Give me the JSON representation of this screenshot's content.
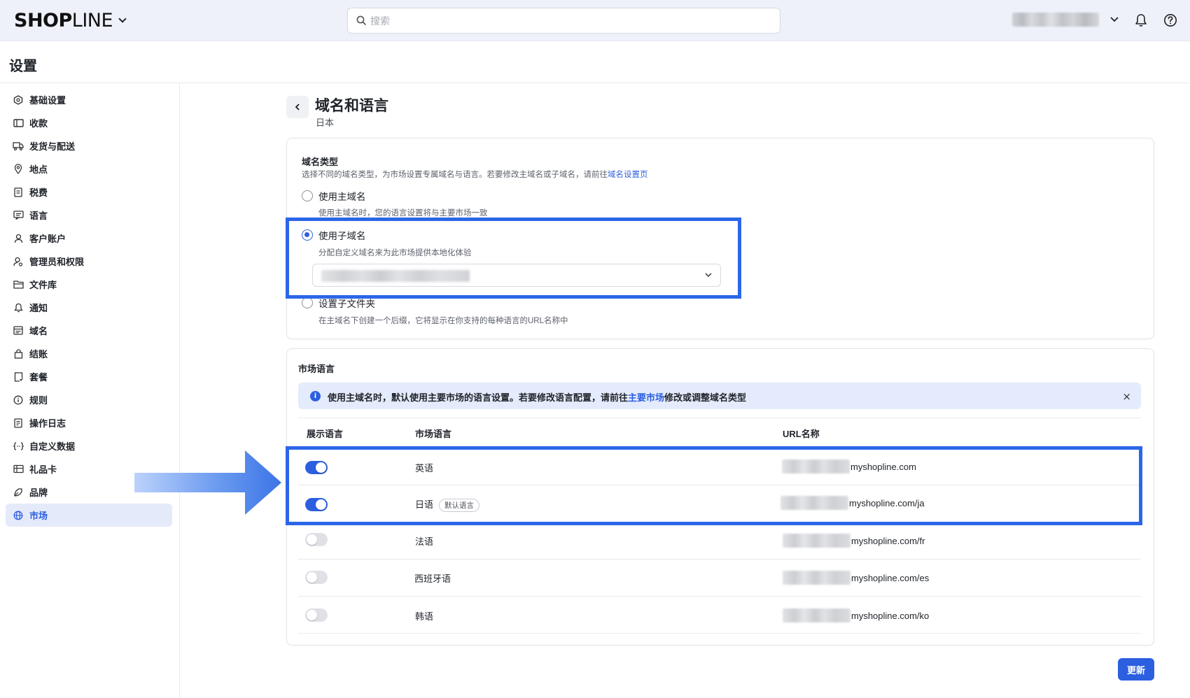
{
  "header": {
    "logo_bold": "SHOP",
    "logo_light": "LINE",
    "search_placeholder": "搜索"
  },
  "page": {
    "title": "设置"
  },
  "sidebar": {
    "items": [
      {
        "label": "基础设置",
        "icon": "hexagon-icon"
      },
      {
        "label": "收款",
        "icon": "wallet-icon"
      },
      {
        "label": "发货与配送",
        "icon": "truck-icon"
      },
      {
        "label": "地点",
        "icon": "location-pin-icon"
      },
      {
        "label": "税费",
        "icon": "receipt-icon"
      },
      {
        "label": "语言",
        "icon": "translate-icon"
      },
      {
        "label": "客户账户",
        "icon": "user-icon"
      },
      {
        "label": "管理员和权限",
        "icon": "admin-user-icon"
      },
      {
        "label": "文件库",
        "icon": "folder-icon"
      },
      {
        "label": "通知",
        "icon": "bell-icon"
      },
      {
        "label": "域名",
        "icon": "domain-icon"
      },
      {
        "label": "结账",
        "icon": "shopping-bag-icon"
      },
      {
        "label": "套餐",
        "icon": "plan-icon"
      },
      {
        "label": "规则",
        "icon": "info-circle-icon"
      },
      {
        "label": "操作日志",
        "icon": "log-icon"
      },
      {
        "label": "自定义数据",
        "icon": "code-braces-icon"
      },
      {
        "label": "礼品卡",
        "icon": "gift-card-icon"
      },
      {
        "label": "品牌",
        "icon": "brand-icon"
      },
      {
        "label": "市场",
        "icon": "globe-icon",
        "active": true
      }
    ]
  },
  "content": {
    "title": "域名和语言",
    "subtitle": "日本",
    "domain_type": {
      "title": "域名类型",
      "desc": "选择不同的域名类型，为市场设置专属域名与语言。若要修改主域名或子域名，请前往",
      "desc_link": "域名设置页",
      "options": [
        {
          "label": "使用主域名",
          "help": "使用主域名时，您的语言设置将与主要市场一致",
          "selected": false
        },
        {
          "label": "使用子域名",
          "help": "分配自定义域名来为此市场提供本地化体验",
          "selected": true
        },
        {
          "label": "设置子文件夹",
          "help": "在主域名下创建一个后缀，它将显示在你支持的每种语言的URL名称中",
          "selected": false
        }
      ]
    },
    "market_language": {
      "title": "市场语言",
      "notice_text": "使用主域名时，默认使用主要市场的语言设置。若要修改语言配置，请前往",
      "notice_link": "主要市场",
      "notice_suffix": "修改或调整域名类型",
      "notice_close": "×",
      "columns": [
        "展示语言",
        "市场语言",
        "URL名称"
      ],
      "rows": [
        {
          "enabled": true,
          "language": "英语",
          "badge": "",
          "url": "myshopline.com"
        },
        {
          "enabled": true,
          "language": "日语",
          "badge": "默认语言",
          "url": "myshopline.com/ja"
        },
        {
          "enabled": false,
          "language": "法语",
          "badge": "",
          "url": "myshopline.com/fr"
        },
        {
          "enabled": false,
          "language": "西班牙语",
          "badge": "",
          "url": "myshopline.com/es"
        },
        {
          "enabled": false,
          "language": "韩语",
          "badge": "",
          "url": "myshopline.com/ko"
        }
      ]
    },
    "update_label": "更新"
  },
  "colors": {
    "accent": "#2c5fe0",
    "highlight": "#2c66e8",
    "topbar_bg": "#eef1f9"
  }
}
